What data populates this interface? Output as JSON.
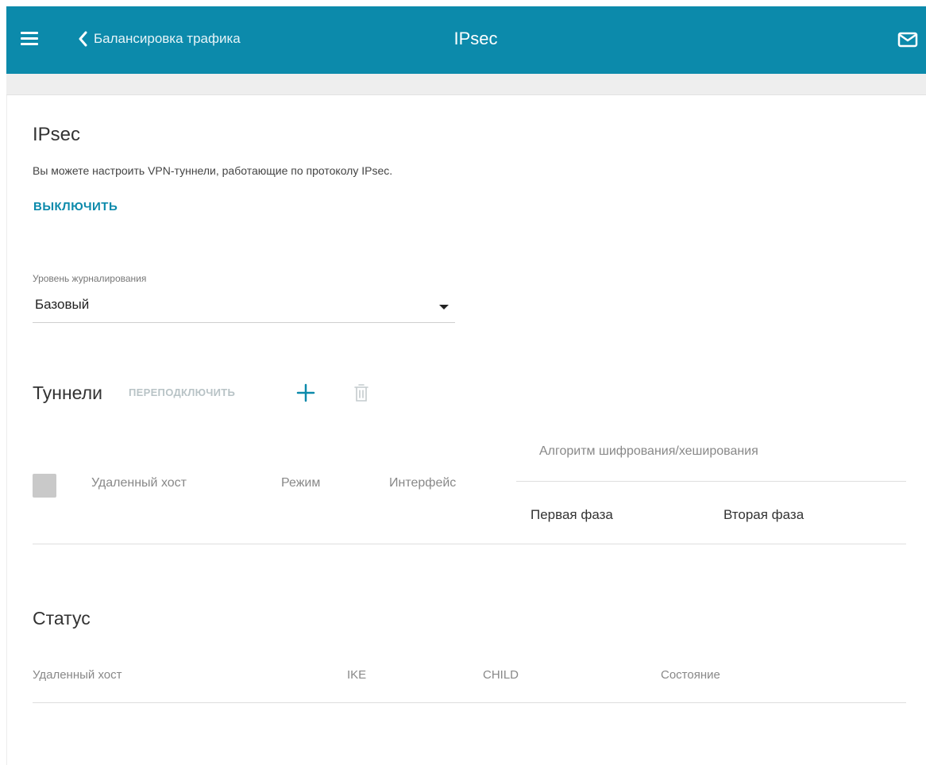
{
  "header": {
    "back_label": "Балансировка трафика",
    "title": "IPsec",
    "icons": [
      "menu-icon",
      "chevron-left-icon",
      "mail-icon"
    ],
    "bg_color": "#0c8aab"
  },
  "ipsec": {
    "title": "IPsec",
    "description": "Вы можете настроить VPN-туннели, работающие по протоколу IPsec.",
    "toggle_label": "ВЫКЛЮЧИТЬ"
  },
  "logging": {
    "label": "Уровень журналирования",
    "value": "Базовый"
  },
  "tunnels": {
    "title": "Туннели",
    "reconnect_label": "ПЕРЕПОДКЛЮЧИТЬ",
    "columns": {
      "remote_host": "Удаленный хост",
      "mode": "Режим",
      "interface": "Интерфейс",
      "algorithm": "Алгоритм шифрования/хеширования",
      "phase1": "Первая фаза",
      "phase2": "Вторая фаза"
    },
    "rows": []
  },
  "status": {
    "title": "Статус",
    "columns": {
      "remote_host": "Удаленный хост",
      "ike": "IKE",
      "child": "CHILD",
      "state": "Состояние"
    },
    "rows": []
  }
}
